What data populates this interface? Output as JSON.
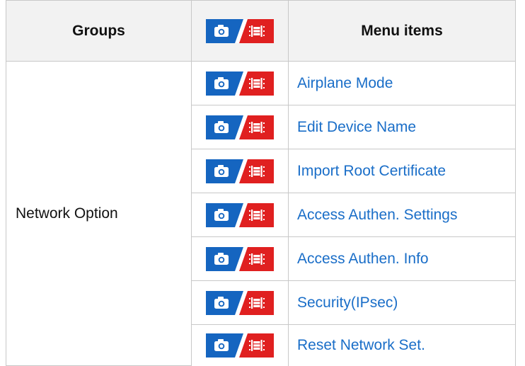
{
  "colors": {
    "photo_mode": "#1565c0",
    "movie_mode": "#e02020",
    "link": "#1a6ec8",
    "header_bg": "#f2f2f2",
    "border": "#c8c8c8"
  },
  "table": {
    "headers": {
      "groups": "Groups",
      "mode_icon": "photo-movie-mode-icon",
      "menu_items": "Menu items"
    },
    "group_name": "Network Option",
    "rows": [
      {
        "mode_icon": "photo-movie-mode-icon",
        "label": "Airplane Mode"
      },
      {
        "mode_icon": "photo-movie-mode-icon",
        "label": "Edit Device Name"
      },
      {
        "mode_icon": "photo-movie-mode-icon",
        "label": "Import Root Certificate"
      },
      {
        "mode_icon": "photo-movie-mode-icon",
        "label": "Access Authen. Settings"
      },
      {
        "mode_icon": "photo-movie-mode-icon",
        "label": "Access Authen. Info"
      },
      {
        "mode_icon": "photo-movie-mode-icon",
        "label": "Security(IPsec)"
      },
      {
        "mode_icon": "photo-movie-mode-icon",
        "label": "Reset Network Set."
      }
    ]
  }
}
